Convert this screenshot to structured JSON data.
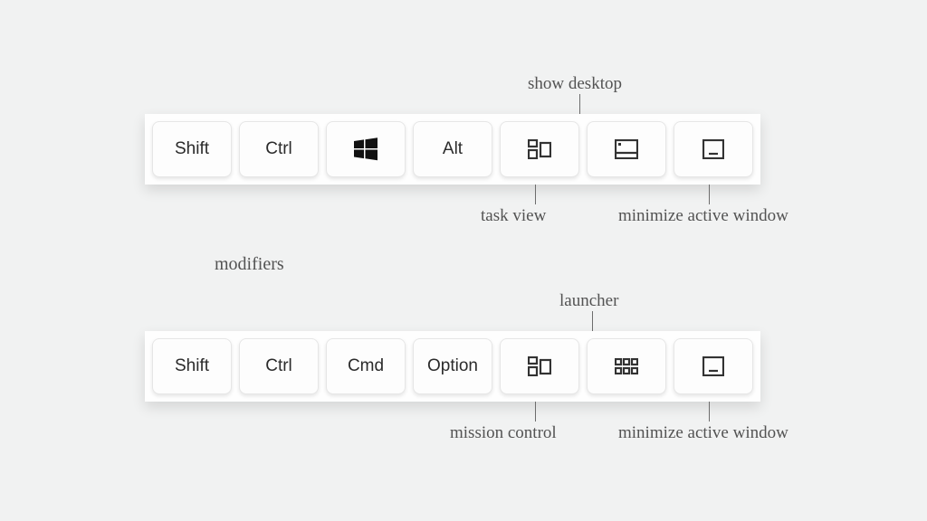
{
  "row1": {
    "keys": [
      {
        "label": "Shift",
        "type": "text"
      },
      {
        "label": "Ctrl",
        "type": "text"
      },
      {
        "label": "",
        "type": "icon",
        "icon": "windows-logo-icon"
      },
      {
        "label": "Alt",
        "type": "text"
      },
      {
        "label": "",
        "type": "icon",
        "icon": "task-view-icon"
      },
      {
        "label": "",
        "type": "icon",
        "icon": "show-desktop-icon"
      },
      {
        "label": "",
        "type": "icon",
        "icon": "minimize-window-icon"
      }
    ],
    "annotations": {
      "show_desktop": "show desktop",
      "task_view": "task view",
      "minimize": "minimize active window"
    }
  },
  "center_label": "modifiers",
  "row2": {
    "keys": [
      {
        "label": "Shift",
        "type": "text"
      },
      {
        "label": "Ctrl",
        "type": "text"
      },
      {
        "label": "Cmd",
        "type": "text"
      },
      {
        "label": "Option",
        "type": "text"
      },
      {
        "label": "",
        "type": "icon",
        "icon": "mission-control-icon"
      },
      {
        "label": "",
        "type": "icon",
        "icon": "launcher-icon"
      },
      {
        "label": "",
        "type": "icon",
        "icon": "minimize-window-icon"
      }
    ],
    "annotations": {
      "launcher": "launcher",
      "mission_control": "mission control",
      "minimize": "minimize active window"
    }
  }
}
